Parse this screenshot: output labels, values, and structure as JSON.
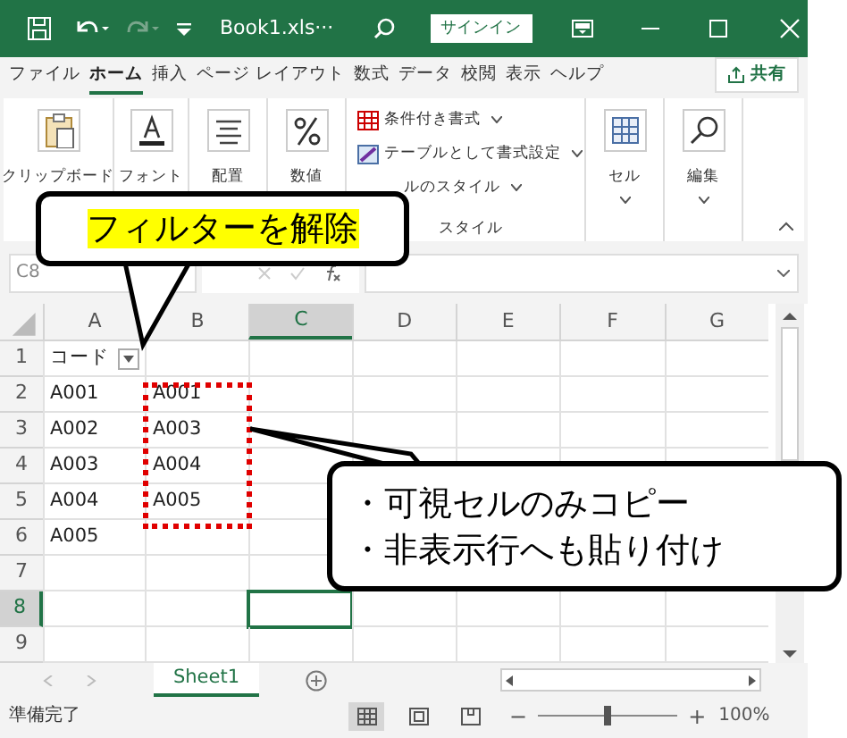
{
  "title_bar": {
    "filename": "Book1.xls···",
    "sign_in": "サインイン"
  },
  "tabs": [
    {
      "label": "ファイル",
      "selected": false
    },
    {
      "label": "ホーム",
      "selected": true
    },
    {
      "label": "挿入",
      "selected": false
    },
    {
      "label": "ページ レイアウト",
      "selected": false
    },
    {
      "label": "数式",
      "selected": false
    },
    {
      "label": "データ",
      "selected": false
    },
    {
      "label": "校閲",
      "selected": false
    },
    {
      "label": "表示",
      "selected": false
    },
    {
      "label": "ヘルプ",
      "selected": false
    }
  ],
  "share": "共有",
  "ribbon": {
    "groups": [
      {
        "label": "クリップボード",
        "kind": "clipboard"
      },
      {
        "label": "フォント",
        "kind": "font"
      },
      {
        "label": "配置",
        "kind": "align"
      },
      {
        "label": "数値",
        "kind": "number"
      }
    ],
    "styles": {
      "items": [
        "条件付き書式",
        "テーブルとして書式設定",
        "ルのスタイル"
      ],
      "label": "スタイル"
    },
    "right_groups": [
      {
        "label": "セル",
        "kind": "cells"
      },
      {
        "label": "編集",
        "kind": "search"
      }
    ]
  },
  "name_box": "C8",
  "columns": [
    {
      "label": "A",
      "selected": false
    },
    {
      "label": "B",
      "selected": false
    },
    {
      "label": "C",
      "selected": true
    },
    {
      "label": "D",
      "selected": false
    },
    {
      "label": "E",
      "selected": false
    },
    {
      "label": "F",
      "selected": false
    },
    {
      "label": "G",
      "selected": false
    }
  ],
  "rows": [
    {
      "number": "1",
      "selected": false,
      "cells": [
        "コード",
        "",
        "",
        "",
        "",
        "",
        ""
      ]
    },
    {
      "number": "2",
      "selected": false,
      "cells": [
        "A001",
        "A001",
        "",
        "",
        "",
        "",
        ""
      ]
    },
    {
      "number": "3",
      "selected": false,
      "cells": [
        "A002",
        "A003",
        "",
        "",
        "",
        "",
        ""
      ]
    },
    {
      "number": "4",
      "selected": false,
      "cells": [
        "A003",
        "A004",
        "",
        "",
        "",
        "",
        ""
      ]
    },
    {
      "number": "5",
      "selected": false,
      "cells": [
        "A004",
        "A005",
        "",
        "",
        "",
        "",
        ""
      ]
    },
    {
      "number": "6",
      "selected": false,
      "cells": [
        "A005",
        "",
        "",
        "",
        "",
        "",
        ""
      ]
    },
    {
      "number": "7",
      "selected": false,
      "cells": [
        "",
        "",
        "",
        "",
        "",
        "",
        ""
      ]
    },
    {
      "number": "8",
      "selected": true,
      "cells": [
        "",
        "",
        "",
        "",
        "",
        "",
        ""
      ]
    },
    {
      "number": "9",
      "selected": false,
      "cells": [
        "",
        "",
        "",
        "",
        "",
        "",
        ""
      ]
    }
  ],
  "sheet_tabs": [
    {
      "label": "Sheet1",
      "selected": true
    }
  ],
  "status_bar": {
    "text": "準備完了",
    "views": [
      {
        "kind": "normal",
        "selected": true
      },
      {
        "kind": "page_layout",
        "selected": false
      },
      {
        "kind": "page_break",
        "selected": false
      }
    ],
    "zoom": {
      "minus": "−",
      "level": 0.5,
      "plus": "+",
      "reading": "100%"
    }
  },
  "callouts": [
    {
      "text": "フィルターを解除"
    },
    {
      "lines": [
        "・可視セルのみコピー",
        "・非表示行へも貼り付け"
      ]
    }
  ]
}
